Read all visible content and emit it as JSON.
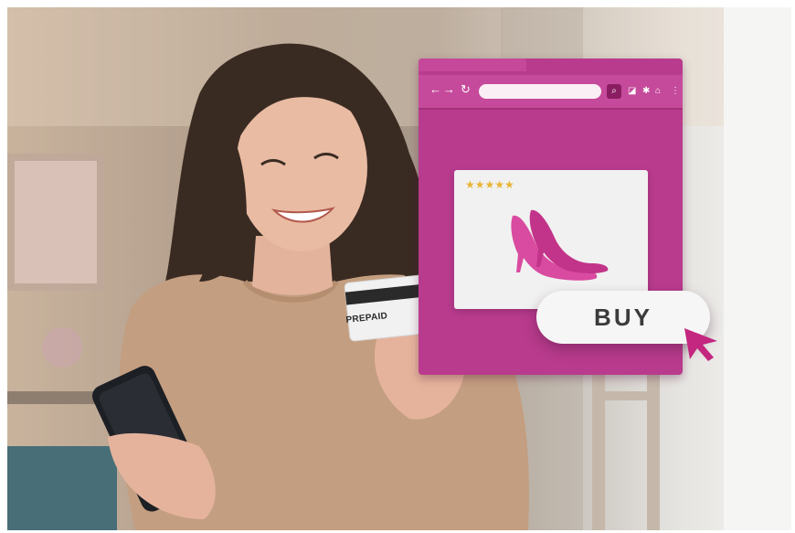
{
  "scene": {
    "card_label": "PREPAID",
    "product_rating": "★★★★★",
    "buy_button_label": "BUY",
    "browser_nav": {
      "back": "←",
      "forward": "→",
      "reload": "↻",
      "search": "⌕",
      "new_tab": "◪",
      "extension": "✱",
      "home": "⌂",
      "menu": "⋮"
    }
  },
  "colors": {
    "browser_magenta": "#b93b8d",
    "button_bg": "#f6f6f6",
    "cursor": "#c3277f",
    "star": "#e8b534"
  }
}
